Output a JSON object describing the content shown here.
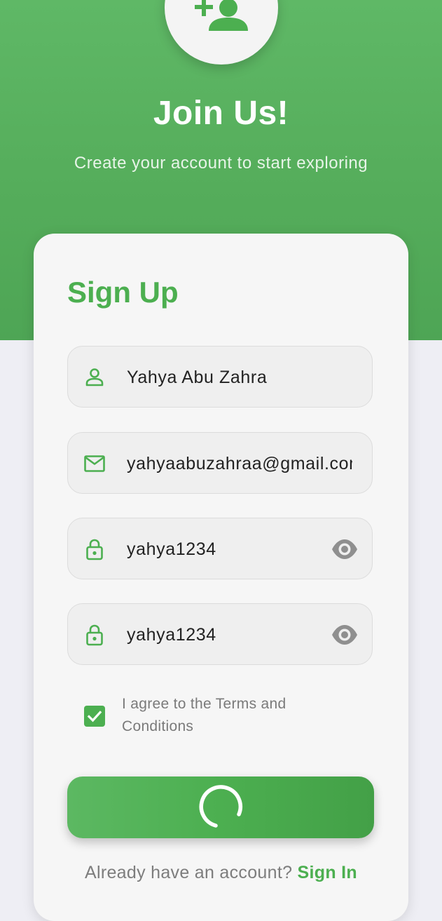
{
  "header": {
    "avatar_icon": "add-person-icon",
    "title": "Join Us!",
    "subtitle": "Create your account to start exploring"
  },
  "form": {
    "title": "Sign Up",
    "name_field": {
      "icon": "person-outline-icon",
      "value": "Yahya Abu Zahra"
    },
    "email_field": {
      "icon": "mail-outline-icon",
      "value": "yahyaabuzahraa@gmail.com"
    },
    "password_field": {
      "icon": "lock-outline-icon",
      "value": "yahya1234",
      "toggle_icon": "eye-icon"
    },
    "confirm_password_field": {
      "icon": "lock-outline-icon",
      "value": "yahya1234",
      "toggle_icon": "eye-icon"
    },
    "terms": {
      "checked": true,
      "label": "I agree to the Terms and Conditions"
    },
    "submit": {
      "state": "loading",
      "icon": "spinner-icon"
    },
    "footer": {
      "question": "Already have an account?",
      "link": "Sign In"
    }
  },
  "colors": {
    "primary": "#4caf50",
    "header_bg": "#55ad5b",
    "page_bg": "#eeeef4",
    "card_bg": "#f6f6f6",
    "field_bg": "#efefef",
    "muted_text": "#7a7a7a"
  }
}
